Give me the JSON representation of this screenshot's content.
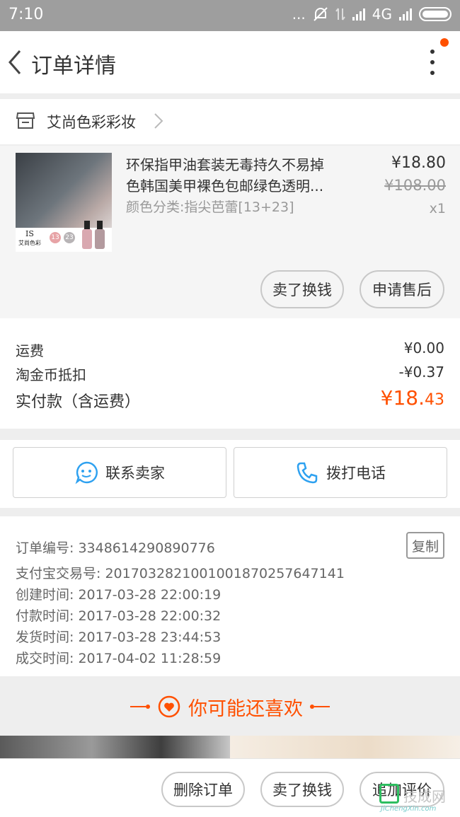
{
  "status_bar": {
    "time": "7:10",
    "dots": "...",
    "network": "4G"
  },
  "nav": {
    "title": "订单详情"
  },
  "shop": {
    "name": "艾尚色彩彩妆"
  },
  "item": {
    "title_line1": "环保指甲油套装无毒持久不易掉",
    "title_line2": "色韩国美甲裸色包邮绿色透明...",
    "sku": "颜色分类:指尖芭蕾[13+23]",
    "price": "¥18.80",
    "original_price": "¥108.00",
    "quantity": "x1",
    "thumb": {
      "logo": "IS",
      "brand": "艾尚色彩",
      "shade1": "13",
      "shade2": "23"
    },
    "sell_button": "卖了换钱",
    "after_sale_button": "申请售后"
  },
  "fees": {
    "shipping_label": "运费",
    "shipping_value": "¥0.00",
    "coin_label": "淘金币抵扣",
    "coin_value": "-¥0.37",
    "paid_label": "实付款（含运费）",
    "paid_value_main": "¥18.",
    "paid_value_cents": "43"
  },
  "contact": {
    "seller": "联系卖家",
    "call": "拨打电话"
  },
  "order_info": {
    "order_no": "订单编号: 3348614290890776",
    "copy_button": "复制",
    "alipay_no": "支付宝交易号: 2017032821001001870257647141",
    "created": "创建时间: 2017-03-28 22:00:19",
    "paid": "付款时间: 2017-03-28 22:00:32",
    "shipped": "发货时间: 2017-03-28 23:44:53",
    "completed": "成交时间: 2017-04-02 11:28:59"
  },
  "recommend": {
    "title": "你可能还喜欢"
  },
  "bottom": {
    "delete": "删除订单",
    "sell": "卖了换钱",
    "review": "追加评价"
  },
  "watermark": {
    "text": "技成网",
    "url": "JiChengXin.com"
  },
  "colors": {
    "accent": "#ff5000",
    "status_bar": "#9e9e9e",
    "icon_blue": "#2ea1f0"
  }
}
